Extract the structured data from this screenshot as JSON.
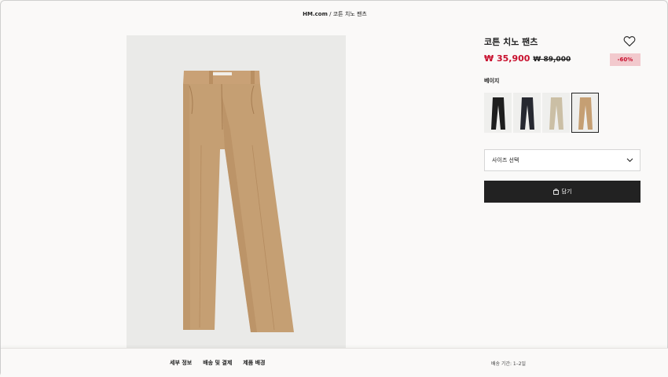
{
  "breadcrumb": {
    "home": "HM.com",
    "separator": "/",
    "current": "코튼 치노 팬츠"
  },
  "product": {
    "title": "코튼 치노 팬츠",
    "price_sale": "₩ 35,900",
    "price_original": "₩ 89,000",
    "discount_badge": "-60%",
    "color_label": "베이지",
    "image_icon": "beige-chino-pants-photo"
  },
  "swatches": [
    {
      "name": "black",
      "color": "#1e1e1e",
      "selected": false
    },
    {
      "name": "dark-navy",
      "color": "#262830",
      "selected": false
    },
    {
      "name": "light-beige",
      "color": "#cbbfa5",
      "selected": false
    },
    {
      "name": "beige",
      "color": "#c59f73",
      "selected": true
    }
  ],
  "size_select": {
    "value": "사이즈 선택",
    "icon": "chevron-down-icon"
  },
  "add_button": {
    "label": "담기",
    "icon": "shopping-bag-icon"
  },
  "footer": {
    "tabs": [
      "세부 정보",
      "배송 및 결제",
      "제품 배경"
    ],
    "delivery": "배송 기간: 1–2일"
  },
  "colors": {
    "sale_red": "#c8102e",
    "badge_bg": "#f2c9cd",
    "button_bg": "#222222",
    "pants_main": "#c59f73"
  }
}
